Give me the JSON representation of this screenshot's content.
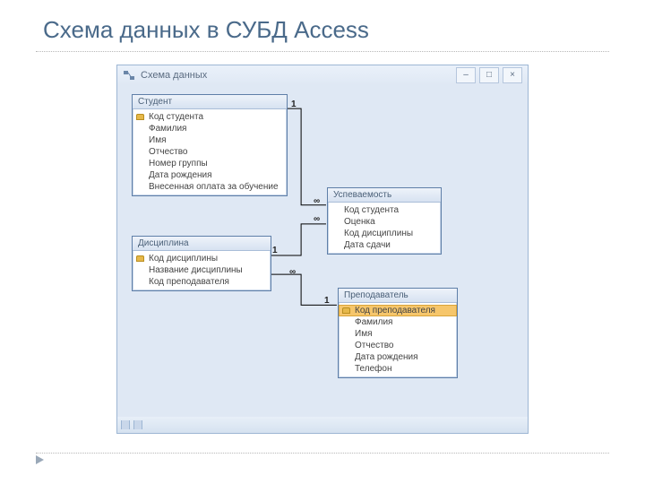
{
  "slide": {
    "title": "Схема данных в СУБД Access"
  },
  "window": {
    "title": "Схема данных"
  },
  "tables": {
    "student": {
      "title": "Студент",
      "fields": [
        "Код студента",
        "Фамилия",
        "Имя",
        "Отчество",
        "Номер группы",
        "Дата рождения",
        "Внесенная оплата за обучение"
      ]
    },
    "discipline": {
      "title": "Дисциплина",
      "fields": [
        "Код дисциплины",
        "Название дисциплины",
        "Код преподавателя"
      ]
    },
    "grades": {
      "title": "Успеваемость",
      "fields": [
        "Код студента",
        "Оценка",
        "Код дисциплины",
        "Дата сдачи"
      ]
    },
    "teacher": {
      "title": "Преподаватель",
      "fields": [
        "Код преподавателя",
        "Фамилия",
        "Имя",
        "Отчество",
        "Дата рождения",
        "Телефон"
      ]
    }
  },
  "cardinalities": {
    "student_grades_one": "1",
    "student_grades_many": "∞",
    "discipline_grades_one": "1",
    "discipline_grades_many": "∞",
    "discipline_teacher_many": "∞",
    "discipline_teacher_one": "1"
  }
}
